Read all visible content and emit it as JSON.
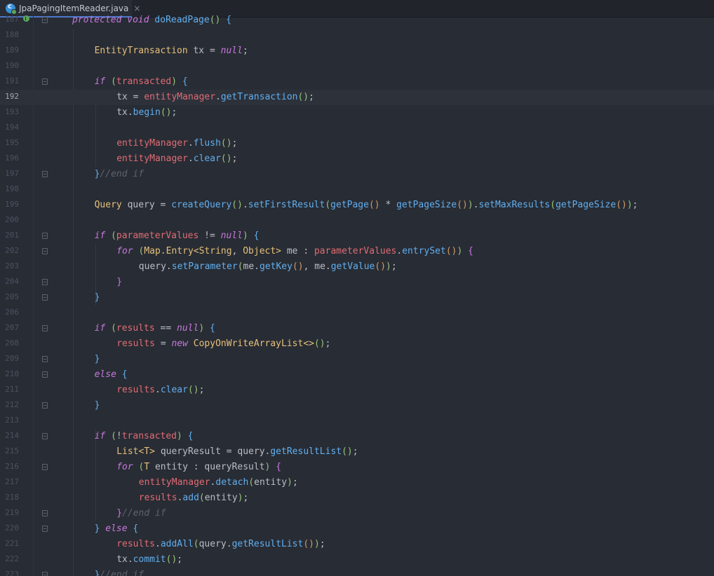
{
  "tab": {
    "file_name": "JpaPagingItemReader.java",
    "icon_letter": "c",
    "close_glyph": "×"
  },
  "editor": {
    "current_line": 192,
    "lines": [
      {
        "n": 187,
        "fold": "start",
        "marker": true,
        "indent": 0,
        "tokens": [
          [
            "kw",
            "protected "
          ],
          [
            "kw",
            "void "
          ],
          [
            "fn",
            "doReadPage"
          ],
          [
            "par",
            "() "
          ],
          [
            "brc",
            "{"
          ]
        ]
      },
      {
        "n": 188,
        "indent": 0,
        "tokens": []
      },
      {
        "n": 189,
        "indent": 1,
        "tokens": [
          [
            "ty",
            "EntityTransaction "
          ],
          [
            "plain",
            "tx = "
          ],
          [
            "kw",
            "null"
          ],
          [
            "pu",
            ";"
          ]
        ]
      },
      {
        "n": 190,
        "indent": 0,
        "tokens": []
      },
      {
        "n": 191,
        "fold": "start",
        "indent": 1,
        "tokens": [
          [
            "kw",
            "if "
          ],
          [
            "par",
            "("
          ],
          [
            "fld",
            "transacted"
          ],
          [
            "par",
            ") "
          ],
          [
            "brc",
            "{"
          ]
        ]
      },
      {
        "n": 192,
        "indent": 2,
        "tokens": [
          [
            "plain",
            "tx = "
          ],
          [
            "fld",
            "entityManager"
          ],
          [
            "pu",
            "."
          ],
          [
            "fn",
            "getTransaction"
          ],
          [
            "par",
            "()"
          ],
          [
            "pu",
            ";"
          ]
        ]
      },
      {
        "n": 193,
        "indent": 2,
        "tokens": [
          [
            "plain",
            "tx."
          ],
          [
            "fn",
            "begin"
          ],
          [
            "par",
            "()"
          ],
          [
            "pu",
            ";"
          ]
        ]
      },
      {
        "n": 194,
        "indent": 0,
        "tokens": []
      },
      {
        "n": 195,
        "indent": 2,
        "tokens": [
          [
            "fld",
            "entityManager"
          ],
          [
            "pu",
            "."
          ],
          [
            "fn",
            "flush"
          ],
          [
            "par",
            "()"
          ],
          [
            "pu",
            ";"
          ]
        ]
      },
      {
        "n": 196,
        "indent": 2,
        "tokens": [
          [
            "fld",
            "entityManager"
          ],
          [
            "pu",
            "."
          ],
          [
            "fn",
            "clear"
          ],
          [
            "par",
            "()"
          ],
          [
            "pu",
            ";"
          ]
        ]
      },
      {
        "n": 197,
        "fold": "end",
        "indent": 1,
        "tokens": [
          [
            "brc",
            "}"
          ],
          [
            "cm",
            "//end if"
          ]
        ]
      },
      {
        "n": 198,
        "indent": 0,
        "tokens": []
      },
      {
        "n": 199,
        "indent": 1,
        "tokens": [
          [
            "ty",
            "Query "
          ],
          [
            "plain",
            "query = "
          ],
          [
            "fn",
            "createQuery"
          ],
          [
            "par",
            "()"
          ],
          [
            "pu",
            "."
          ],
          [
            "fn",
            "setFirstResult"
          ],
          [
            "par",
            "("
          ],
          [
            "fn",
            "getPage"
          ],
          [
            "brk",
            "() "
          ],
          [
            "op",
            "* "
          ],
          [
            "fn",
            "getPageSize"
          ],
          [
            "brk",
            "()"
          ],
          [
            "par",
            ")"
          ],
          [
            "pu",
            "."
          ],
          [
            "fn",
            "setMaxResults"
          ],
          [
            "par",
            "("
          ],
          [
            "fn",
            "getPageSize"
          ],
          [
            "brk",
            "()"
          ],
          [
            "par",
            ")"
          ],
          [
            "pu",
            ";"
          ]
        ]
      },
      {
        "n": 200,
        "indent": 0,
        "tokens": []
      },
      {
        "n": 201,
        "fold": "start",
        "indent": 1,
        "tokens": [
          [
            "kw",
            "if "
          ],
          [
            "par",
            "("
          ],
          [
            "fld",
            "parameterValues "
          ],
          [
            "op",
            "!= "
          ],
          [
            "kw",
            "null"
          ],
          [
            "par",
            ") "
          ],
          [
            "brc",
            "{"
          ]
        ]
      },
      {
        "n": 202,
        "fold": "start",
        "indent": 2,
        "tokens": [
          [
            "kw",
            "for "
          ],
          [
            "par",
            "("
          ],
          [
            "ty",
            "Map.Entry<String"
          ],
          [
            "pu",
            ", "
          ],
          [
            "ty",
            "Object> "
          ],
          [
            "plain",
            "me : "
          ],
          [
            "fld",
            "parameterValues"
          ],
          [
            "pu",
            "."
          ],
          [
            "fn",
            "entrySet"
          ],
          [
            "brk",
            "()"
          ],
          [
            "par",
            ") "
          ],
          [
            "brc2",
            "{"
          ]
        ]
      },
      {
        "n": 203,
        "indent": 3,
        "tokens": [
          [
            "plain",
            "query."
          ],
          [
            "fn",
            "setParameter"
          ],
          [
            "par",
            "("
          ],
          [
            "plain",
            "me."
          ],
          [
            "fn",
            "getKey"
          ],
          [
            "brk",
            "()"
          ],
          [
            "pu",
            ", "
          ],
          [
            "plain",
            "me."
          ],
          [
            "fn",
            "getValue"
          ],
          [
            "brk",
            "()"
          ],
          [
            "par",
            ")"
          ],
          [
            "pu",
            ";"
          ]
        ]
      },
      {
        "n": 204,
        "fold": "end",
        "indent": 2,
        "tokens": [
          [
            "brc2",
            "}"
          ]
        ]
      },
      {
        "n": 205,
        "fold": "end",
        "indent": 1,
        "tokens": [
          [
            "brc",
            "}"
          ]
        ]
      },
      {
        "n": 206,
        "indent": 0,
        "tokens": []
      },
      {
        "n": 207,
        "fold": "start",
        "indent": 1,
        "tokens": [
          [
            "kw",
            "if "
          ],
          [
            "par",
            "("
          ],
          [
            "fld",
            "results "
          ],
          [
            "op",
            "== "
          ],
          [
            "kw",
            "null"
          ],
          [
            "par",
            ") "
          ],
          [
            "brc",
            "{"
          ]
        ]
      },
      {
        "n": 208,
        "indent": 2,
        "tokens": [
          [
            "fld",
            "results "
          ],
          [
            "plain",
            "= "
          ],
          [
            "kw",
            "new "
          ],
          [
            "ty",
            "CopyOnWriteArrayList<>"
          ],
          [
            "par",
            "()"
          ],
          [
            "pu",
            ";"
          ]
        ]
      },
      {
        "n": 209,
        "fold": "end",
        "indent": 1,
        "tokens": [
          [
            "brc",
            "}"
          ]
        ]
      },
      {
        "n": 210,
        "fold": "start",
        "indent": 1,
        "tokens": [
          [
            "kw",
            "else "
          ],
          [
            "brc",
            "{"
          ]
        ]
      },
      {
        "n": 211,
        "indent": 2,
        "tokens": [
          [
            "fld",
            "results"
          ],
          [
            "pu",
            "."
          ],
          [
            "fn",
            "clear"
          ],
          [
            "par",
            "()"
          ],
          [
            "pu",
            ";"
          ]
        ]
      },
      {
        "n": 212,
        "fold": "end",
        "indent": 1,
        "tokens": [
          [
            "brc",
            "}"
          ]
        ]
      },
      {
        "n": 213,
        "indent": 0,
        "tokens": []
      },
      {
        "n": 214,
        "fold": "start",
        "indent": 1,
        "tokens": [
          [
            "kw",
            "if "
          ],
          [
            "par",
            "("
          ],
          [
            "op",
            "!"
          ],
          [
            "fld",
            "transacted"
          ],
          [
            "par",
            ") "
          ],
          [
            "brc",
            "{"
          ]
        ]
      },
      {
        "n": 215,
        "indent": 2,
        "tokens": [
          [
            "ty",
            "List<T> "
          ],
          [
            "plain",
            "queryResult = query."
          ],
          [
            "fn",
            "getResultList"
          ],
          [
            "par",
            "()"
          ],
          [
            "pu",
            ";"
          ]
        ]
      },
      {
        "n": 216,
        "fold": "start",
        "indent": 2,
        "tokens": [
          [
            "kw",
            "for "
          ],
          [
            "par",
            "("
          ],
          [
            "ty",
            "T "
          ],
          [
            "plain",
            "entity : queryResult"
          ],
          [
            "par",
            ") "
          ],
          [
            "brc2",
            "{"
          ]
        ]
      },
      {
        "n": 217,
        "indent": 3,
        "tokens": [
          [
            "fld",
            "entityManager"
          ],
          [
            "pu",
            "."
          ],
          [
            "fn",
            "detach"
          ],
          [
            "par",
            "("
          ],
          [
            "plain",
            "entity"
          ],
          [
            "par",
            ")"
          ],
          [
            "pu",
            ";"
          ]
        ]
      },
      {
        "n": 218,
        "indent": 3,
        "tokens": [
          [
            "fld",
            "results"
          ],
          [
            "pu",
            "."
          ],
          [
            "fn",
            "add"
          ],
          [
            "par",
            "("
          ],
          [
            "plain",
            "entity"
          ],
          [
            "par",
            ")"
          ],
          [
            "pu",
            ";"
          ]
        ]
      },
      {
        "n": 219,
        "fold": "end",
        "indent": 2,
        "tokens": [
          [
            "brc2",
            "}"
          ],
          [
            "cm",
            "//end if"
          ]
        ]
      },
      {
        "n": 220,
        "fold": "start",
        "indent": 1,
        "tokens": [
          [
            "brc",
            "} "
          ],
          [
            "kw",
            "else "
          ],
          [
            "brc",
            "{"
          ]
        ]
      },
      {
        "n": 221,
        "indent": 2,
        "tokens": [
          [
            "fld",
            "results"
          ],
          [
            "pu",
            "."
          ],
          [
            "fn",
            "addAll"
          ],
          [
            "par",
            "("
          ],
          [
            "plain",
            "query."
          ],
          [
            "fn",
            "getResultList"
          ],
          [
            "brk",
            "()"
          ],
          [
            "par",
            ")"
          ],
          [
            "pu",
            ";"
          ]
        ]
      },
      {
        "n": 222,
        "indent": 2,
        "tokens": [
          [
            "plain",
            "tx."
          ],
          [
            "fn",
            "commit"
          ],
          [
            "par",
            "()"
          ],
          [
            "pu",
            ";"
          ]
        ]
      },
      {
        "n": 223,
        "fold": "end",
        "indent": 1,
        "tokens": [
          [
            "brc",
            "}"
          ],
          [
            "cm",
            "//end if"
          ]
        ]
      }
    ]
  }
}
